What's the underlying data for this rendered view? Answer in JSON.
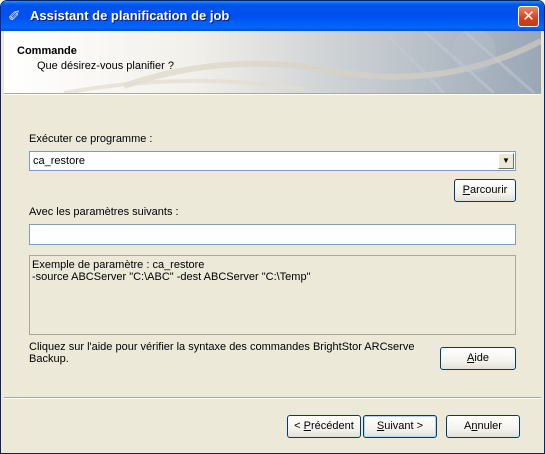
{
  "window": {
    "title": "Assistant de planification de job",
    "close_glyph": "✕",
    "icon": "wizard-icon"
  },
  "header": {
    "title": "Commande",
    "subtitle": "Que désirez-vous planifier ?"
  },
  "program": {
    "label": "Exécuter ce programme :",
    "value": "ca_restore",
    "browse_button": {
      "mnemonic": "P",
      "rest": "arcourir"
    }
  },
  "parameters": {
    "label": "Avec les paramètres suivants :",
    "value": ""
  },
  "example": {
    "line1": "Exemple de paramètre : ca_restore",
    "line2": "-source ABCServer \"C:\\ABC\" -dest ABCServer \"C:\\Temp\""
  },
  "help": {
    "text_line1": "Cliquez sur l'aide pour vérifier la syntaxe des commandes BrightStor ARCserve",
    "text_line2": "Backup.",
    "button": {
      "mnemonic": "A",
      "rest": "ide"
    }
  },
  "navigation": {
    "back": {
      "prefix": "< ",
      "mnemonic": "P",
      "rest": "récédent"
    },
    "next": {
      "mnemonic": "S",
      "rest": "uivant >"
    },
    "cancel": {
      "prefix": "A",
      "mnemonic": "n",
      "rest": "nuler"
    }
  }
}
